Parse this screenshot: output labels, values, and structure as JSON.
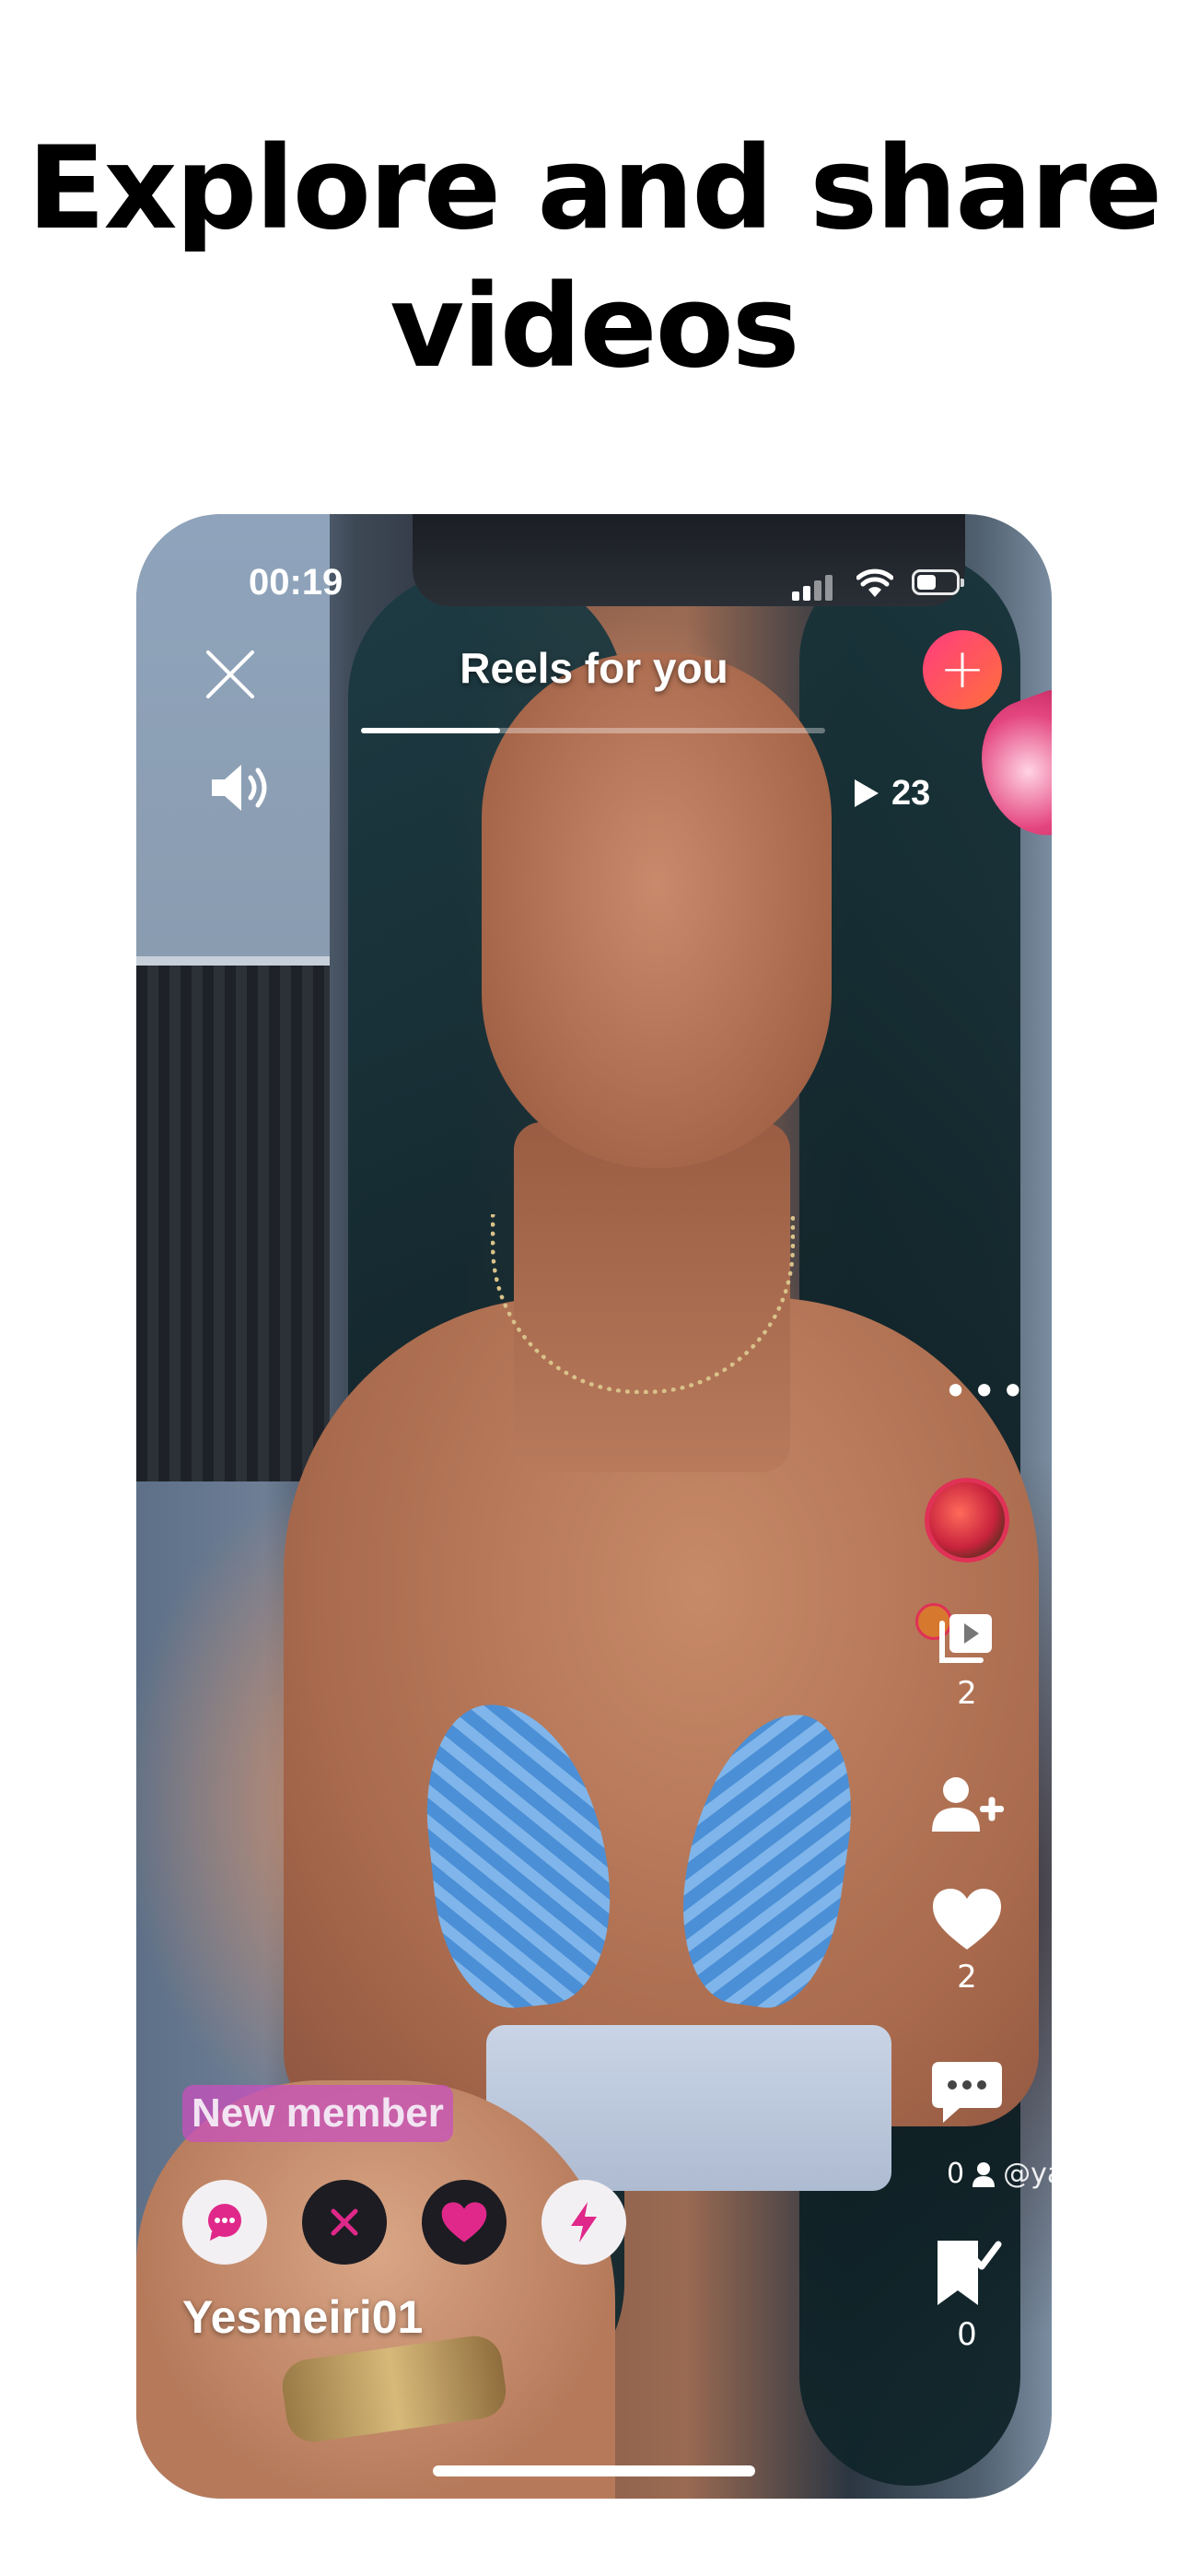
{
  "headline": {
    "line1": "Explore and share",
    "line2": "videos"
  },
  "status_bar": {
    "time": "00:19"
  },
  "header": {
    "title": "Reels for you",
    "progress": 0.3
  },
  "views": {
    "count": "23"
  },
  "side_actions": {
    "reels_count": "2",
    "likes_count": "2",
    "comments_count": "0",
    "tag_handle": "@ya",
    "saves_count": "0"
  },
  "creator": {
    "badge": "New member",
    "username": "Yesmeiri01"
  },
  "colors": {
    "accent": "#ff3d7f",
    "accent_orange": "#ff6f3c",
    "heart_pink": "#e0288a",
    "badge_bg": "#c850be"
  },
  "icons": [
    "close-icon",
    "plus-icon",
    "speaker-icon",
    "play-icon",
    "more-icon",
    "reels-icon",
    "add-user-icon",
    "heart-icon",
    "comment-icon",
    "user-icon",
    "bookmark-check-icon",
    "chat-icon",
    "x-icon",
    "lightning-icon"
  ]
}
